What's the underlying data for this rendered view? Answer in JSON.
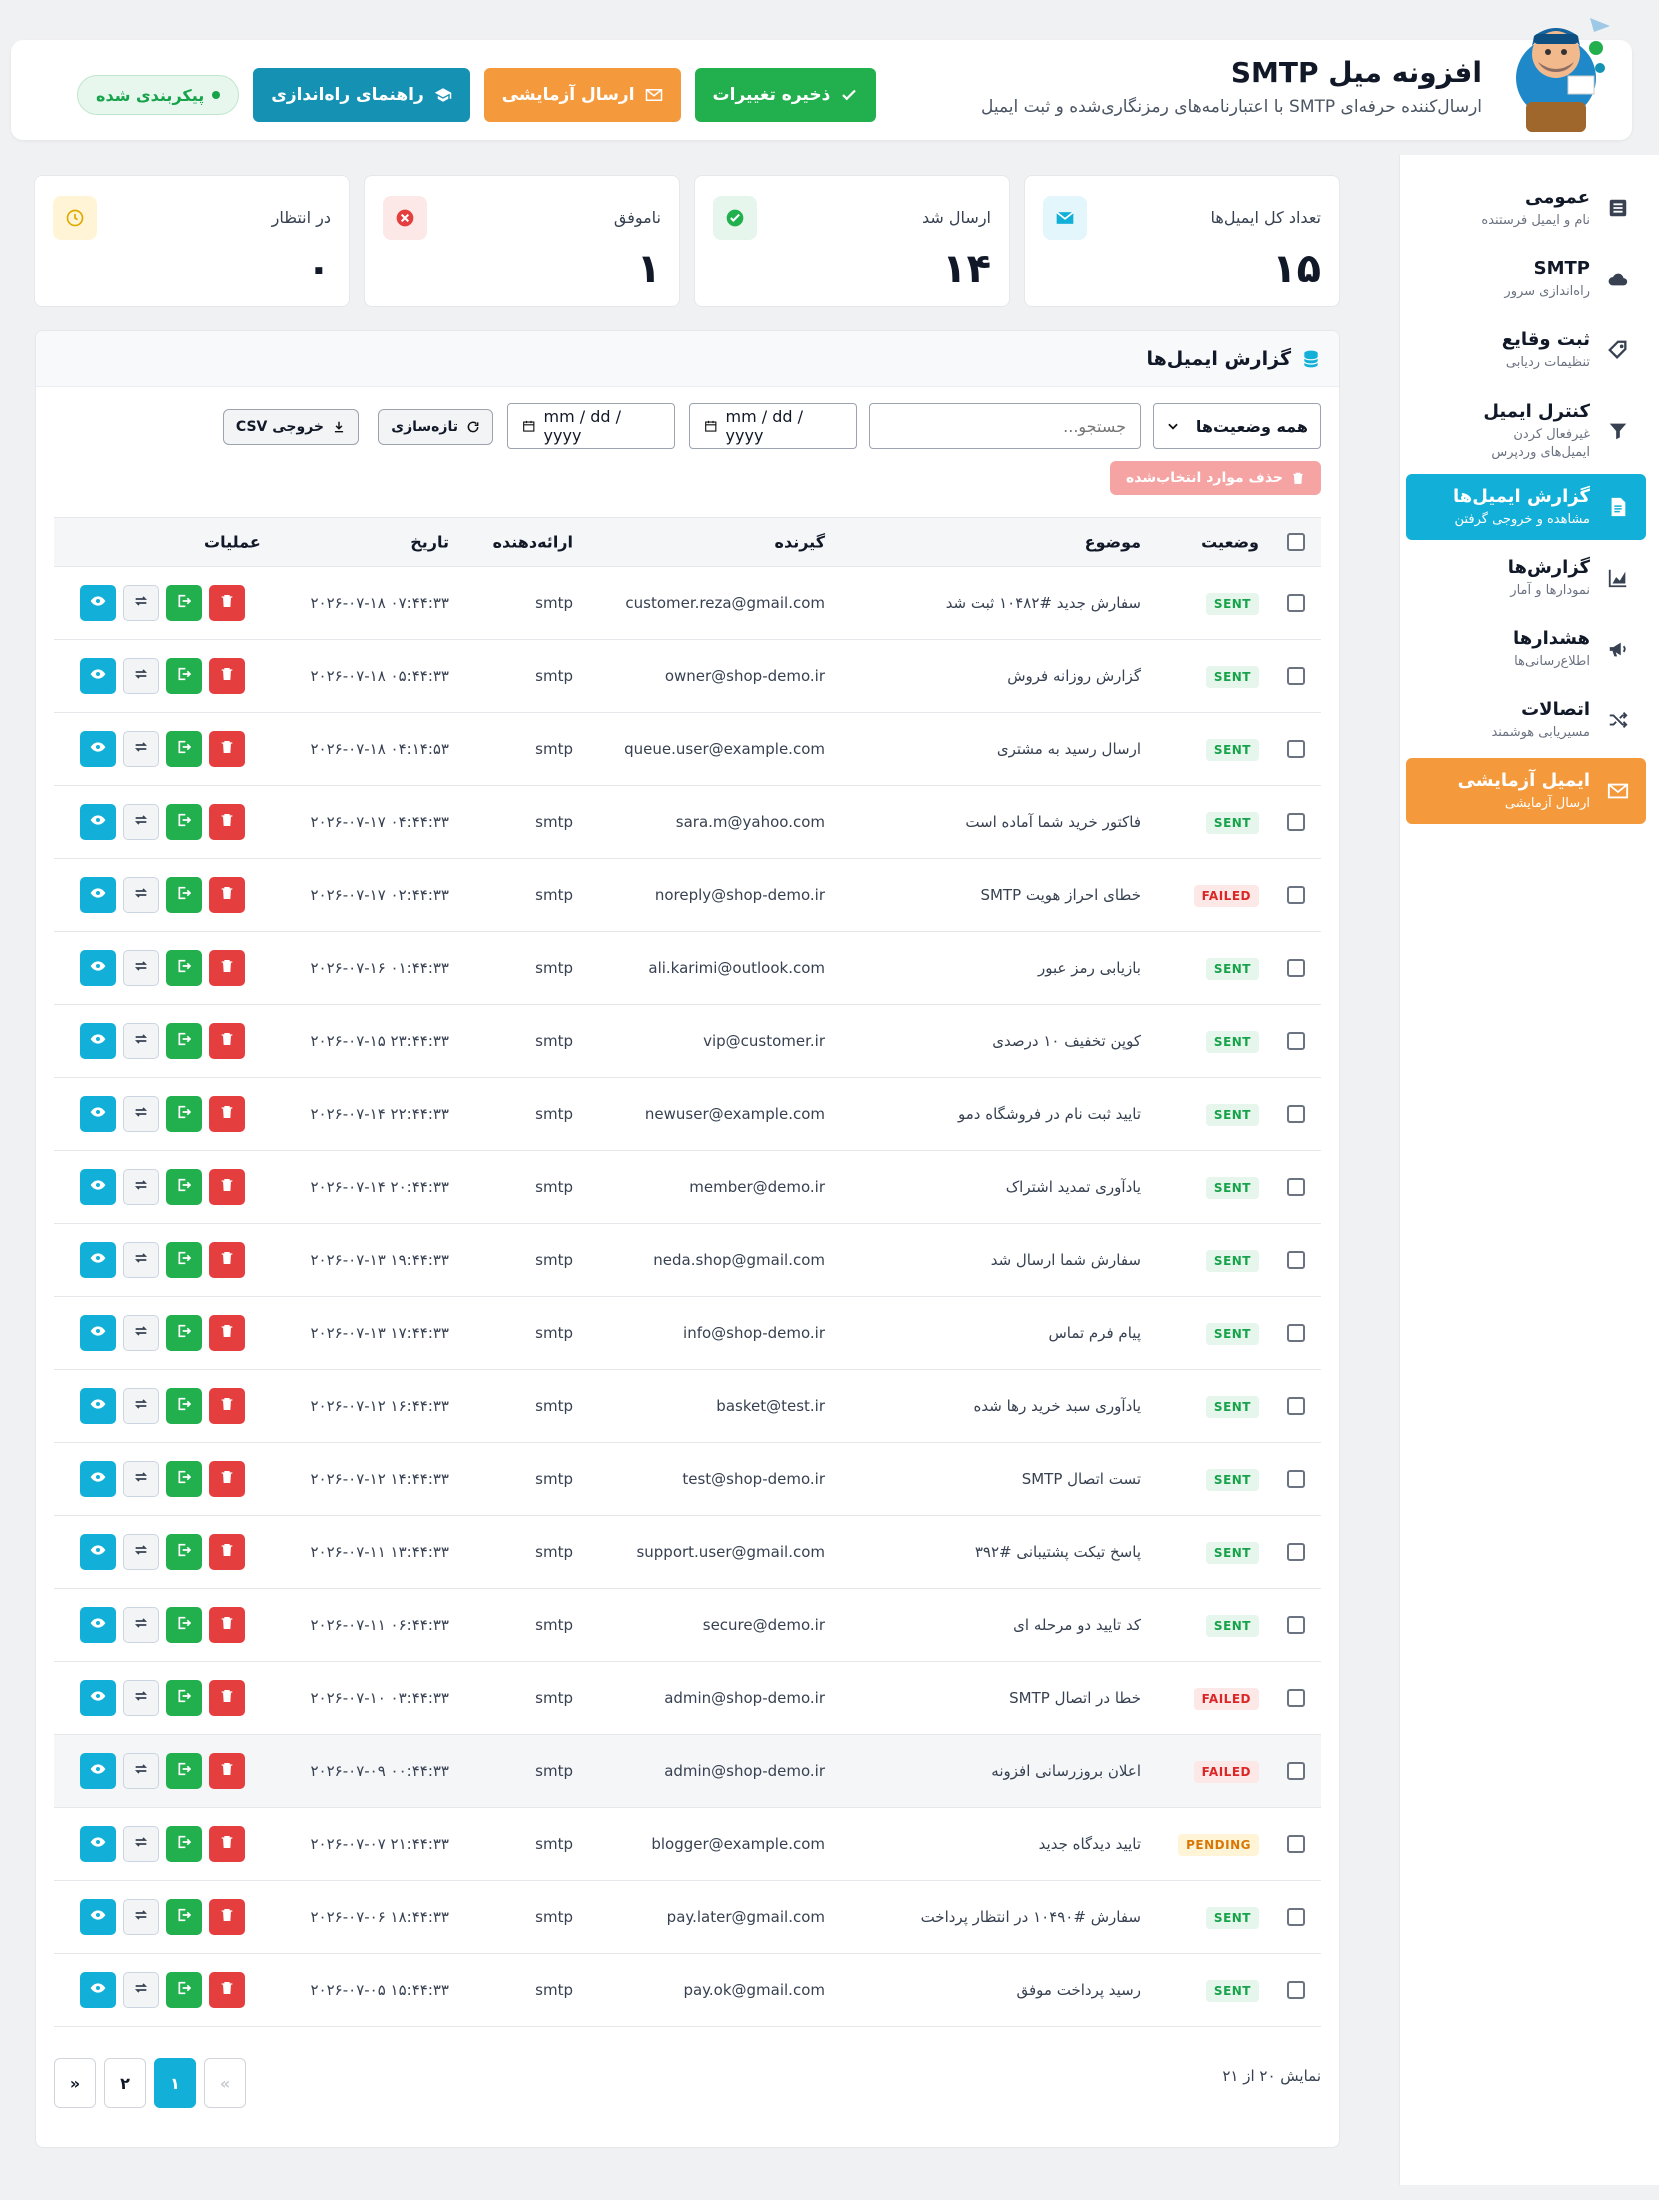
{
  "header": {
    "title": "افزونه میل SMTP",
    "subtitle": "ارسال‌کننده حرفه‌ای SMTP با اعتبارنامه‌های رمزنگاری‌شده و ثبت ایمیل",
    "status": "پیکربندی شده",
    "guide_button": "راهنمای راه‌اندازی",
    "test_button": "ارسال آزمایشی",
    "save_button": "ذخیره تغییرات"
  },
  "sidebar": {
    "items": [
      {
        "title": "عمومی",
        "sub": "نام و ایمیل فرستنده",
        "icon": "settings-sliders-icon"
      },
      {
        "title": "SMTP",
        "sub": "راه‌اندازی سرور",
        "icon": "cloud-icon"
      },
      {
        "title": "ثبت وقایع",
        "sub": "تنظیمات ردیابی",
        "icon": "tag-icon"
      },
      {
        "title": "کنترل ایمیل",
        "sub": "غیرفعال کردن ایمیل‌های وردپرس",
        "icon": "filter-icon"
      },
      {
        "title": "گزارش ایمیل‌ها",
        "sub": "مشاهده و خروجی گرفتن",
        "icon": "document-icon"
      },
      {
        "title": "گزارش‌ها",
        "sub": "نمودارها و آمار",
        "icon": "chart-icon"
      },
      {
        "title": "هشدارها",
        "sub": "اطلاع‌رسانی‌ها",
        "icon": "megaphone-icon"
      },
      {
        "title": "اتصالات",
        "sub": "مسیریابی هوشمند",
        "icon": "shuffle-icon"
      },
      {
        "title": "ایمیل آزمایشی",
        "sub": "ارسال آزمایشی",
        "icon": "mail-icon"
      }
    ]
  },
  "stats": {
    "total": {
      "label": "تعداد کل ایمیل‌ها",
      "value": "۱۵"
    },
    "sent": {
      "label": "ارسال شد",
      "value": "۱۴"
    },
    "failed": {
      "label": "ناموفق",
      "value": "۱"
    },
    "pending": {
      "label": "در انتظار",
      "value": "۰"
    }
  },
  "report": {
    "title": "گزارش ایمیل‌ها",
    "status_filter": "همه وضعیت‌ها",
    "search_placeholder": "جستجو...",
    "date_from": "mm / dd / yyyy",
    "date_to": "mm / dd / yyyy",
    "refresh_button": "تازه‌سازی",
    "export_button": "خروجی CSV",
    "delete_selected": "حذف موارد انتخاب‌شده",
    "columns": {
      "status": "وضعیت",
      "subject": "موضوع",
      "recipient": "گیرنده",
      "provider": "ارائه‌دهنده",
      "date": "تاریخ",
      "actions": "عملیات"
    },
    "rows": [
      {
        "status": "SENT",
        "subject": "سفارش جدید #۱۰۴۸۲ ثبت شد",
        "recipient": "customer.reza@gmail.com",
        "provider": "smtp",
        "date": "۲۰۲۶-۰۷-۱۸ ۰۷:۴۴:۳۳"
      },
      {
        "status": "SENT",
        "subject": "گزارش روزانه فروش",
        "recipient": "owner@shop-demo.ir",
        "provider": "smtp",
        "date": "۲۰۲۶-۰۷-۱۸ ۰۵:۴۴:۳۳"
      },
      {
        "status": "SENT",
        "subject": "ارسال رسید به مشتری",
        "recipient": "queue.user@example.com",
        "provider": "smtp",
        "date": "۲۰۲۶-۰۷-۱۸ ۰۴:۱۴:۵۳"
      },
      {
        "status": "SENT",
        "subject": "فاکتور خرید شما آماده است",
        "recipient": "sara.m@yahoo.com",
        "provider": "smtp",
        "date": "۲۰۲۶-۰۷-۱۷ ۰۴:۴۴:۳۳"
      },
      {
        "status": "FAILED",
        "subject": "خطای احراز هویت SMTP",
        "recipient": "noreply@shop-demo.ir",
        "provider": "smtp",
        "date": "۲۰۲۶-۰۷-۱۷ ۰۲:۴۴:۳۳"
      },
      {
        "status": "SENT",
        "subject": "بازیابی رمز عبور",
        "recipient": "ali.karimi@outlook.com",
        "provider": "smtp",
        "date": "۲۰۲۶-۰۷-۱۶ ۰۱:۴۴:۳۳"
      },
      {
        "status": "SENT",
        "subject": "کوپن تخفیف ۱۰ درصدی",
        "recipient": "vip@customer.ir",
        "provider": "smtp",
        "date": "۲۰۲۶-۰۷-۱۵ ۲۳:۴۴:۳۳"
      },
      {
        "status": "SENT",
        "subject": "تایید ثبت نام در فروشگاه دمو",
        "recipient": "newuser@example.com",
        "provider": "smtp",
        "date": "۲۰۲۶-۰۷-۱۴ ۲۲:۴۴:۳۳"
      },
      {
        "status": "SENT",
        "subject": "یادآوری تمدید اشتراک",
        "recipient": "member@demo.ir",
        "provider": "smtp",
        "date": "۲۰۲۶-۰۷-۱۴ ۲۰:۴۴:۳۳"
      },
      {
        "status": "SENT",
        "subject": "سفارش شما ارسال شد",
        "recipient": "neda.shop@gmail.com",
        "provider": "smtp",
        "date": "۲۰۲۶-۰۷-۱۳ ۱۹:۴۴:۳۳"
      },
      {
        "status": "SENT",
        "subject": "پیام فرم تماس",
        "recipient": "info@shop-demo.ir",
        "provider": "smtp",
        "date": "۲۰۲۶-۰۷-۱۳ ۱۷:۴۴:۳۳"
      },
      {
        "status": "SENT",
        "subject": "یادآوری سبد خرید رها شده",
        "recipient": "basket@test.ir",
        "provider": "smtp",
        "date": "۲۰۲۶-۰۷-۱۲ ۱۶:۴۴:۳۳"
      },
      {
        "status": "SENT",
        "subject": "تست اتصال SMTP",
        "recipient": "test@shop-demo.ir",
        "provider": "smtp",
        "date": "۲۰۲۶-۰۷-۱۲ ۱۴:۴۴:۳۳"
      },
      {
        "status": "SENT",
        "subject": "پاسخ تیکت پشتیبانی #۳۹۲",
        "recipient": "support.user@gmail.com",
        "provider": "smtp",
        "date": "۲۰۲۶-۰۷-۱۱ ۱۳:۴۴:۳۳"
      },
      {
        "status": "SENT",
        "subject": "کد تایید دو مرحله ای",
        "recipient": "secure@demo.ir",
        "provider": "smtp",
        "date": "۲۰۲۶-۰۷-۱۱ ۰۶:۴۴:۳۳"
      },
      {
        "status": "FAILED",
        "subject": "خطا در اتصال SMTP",
        "recipient": "admin@shop-demo.ir",
        "provider": "smtp",
        "date": "۲۰۲۶-۰۷-۱۰ ۰۳:۴۴:۳۳"
      },
      {
        "status": "FAILED",
        "subject": "اعلان بروزرسانی افزونه",
        "recipient": "admin@shop-demo.ir",
        "provider": "smtp",
        "date": "۲۰۲۶-۰۷-۰۹ ۰۰:۴۴:۳۳"
      },
      {
        "status": "PENDING",
        "subject": "تایید دیدگاه جدید",
        "recipient": "blogger@example.com",
        "provider": "smtp",
        "date": "۲۰۲۶-۰۷-۰۷ ۲۱:۴۴:۳۳"
      },
      {
        "status": "SENT",
        "subject": "سفارش #۱۰۴۹۰ در انتظار پرداخت",
        "recipient": "pay.later@gmail.com",
        "provider": "smtp",
        "date": "۲۰۲۶-۰۷-۰۶ ۱۸:۴۴:۳۳"
      },
      {
        "status": "SENT",
        "subject": "رسید پرداخت موفق",
        "recipient": "pay.ok@gmail.com",
        "provider": "smtp",
        "date": "۲۰۲۶-۰۷-۰۵ ۱۵:۴۴:۳۳"
      }
    ],
    "pagination": {
      "info": "نمایش ۲۰ از ۲۱",
      "prev": "«",
      "pages": [
        "۱",
        "۲"
      ],
      "next": "»",
      "current": "۱"
    }
  },
  "colors": {
    "accent": "#12b0d8",
    "orange": "#f49a3d",
    "green": "#22b04f",
    "red": "#e53e3e"
  }
}
